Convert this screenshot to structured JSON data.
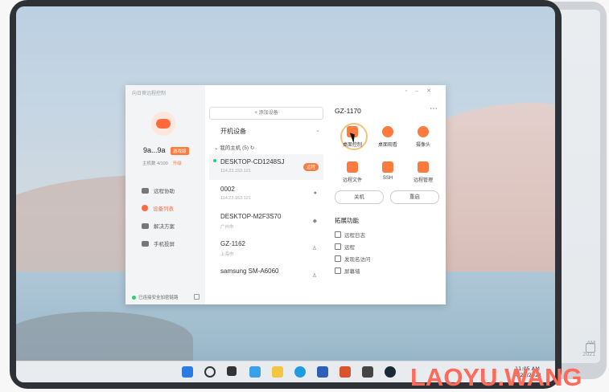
{
  "background_clock": {
    "time": "AM",
    "date": "2021"
  },
  "app": {
    "title": "向日葵远程控制",
    "user": {
      "name": "9a...9a",
      "badge": "游戏版",
      "stats": "主机数  4/100",
      "stats_link": "升级"
    },
    "nav": [
      {
        "label": "远程协助",
        "icon": "remote-assist-icon"
      },
      {
        "label": "设备列表",
        "icon": "device-list-icon"
      },
      {
        "label": "解决方案",
        "icon": "solution-icon"
      },
      {
        "label": "手机投屏",
        "icon": "phone-cast-icon"
      }
    ],
    "footer_status": "已连接安全加密链路",
    "add_device": "+ 添加设备",
    "dropdown_value": "开机设备",
    "group_label": "我的主机 (5)",
    "devices": [
      {
        "name": "DESKTOP-CD1248SJ",
        "sub": "114.23.153.121",
        "tag": "远程",
        "os": ""
      },
      {
        "name": "0002",
        "sub": "114.23.153.121",
        "tag": "",
        "os": "apple-icon"
      },
      {
        "name": "DESKTOP-M2F3S70",
        "sub": "广州市",
        "tag": "",
        "os": "android-icon"
      },
      {
        "name": "GZ-1162",
        "sub": "上海市",
        "tag": "",
        "os": "linux-icon"
      },
      {
        "name": "samsung SM-A6060",
        "sub": "",
        "tag": "",
        "os": "linux-icon"
      }
    ],
    "panel": {
      "device_title": "GZ-1170",
      "actions": [
        "桌面控制",
        "桌面观看",
        "摄像头",
        "远程文件",
        "SSH",
        "远程管理"
      ],
      "power_off": "关机",
      "restart": "重启",
      "ext_title": "拓展功能",
      "ext_items": [
        "远程日志",
        "远程",
        "发现名访问",
        "屏幕墙"
      ]
    }
  },
  "taskbar": {
    "time": "11:05 AM",
    "date": "4/21/2021"
  },
  "watermark": "LAOYU.WANG",
  "colors": {
    "accent": "#ff7a3d",
    "online": "#2ecc71"
  }
}
